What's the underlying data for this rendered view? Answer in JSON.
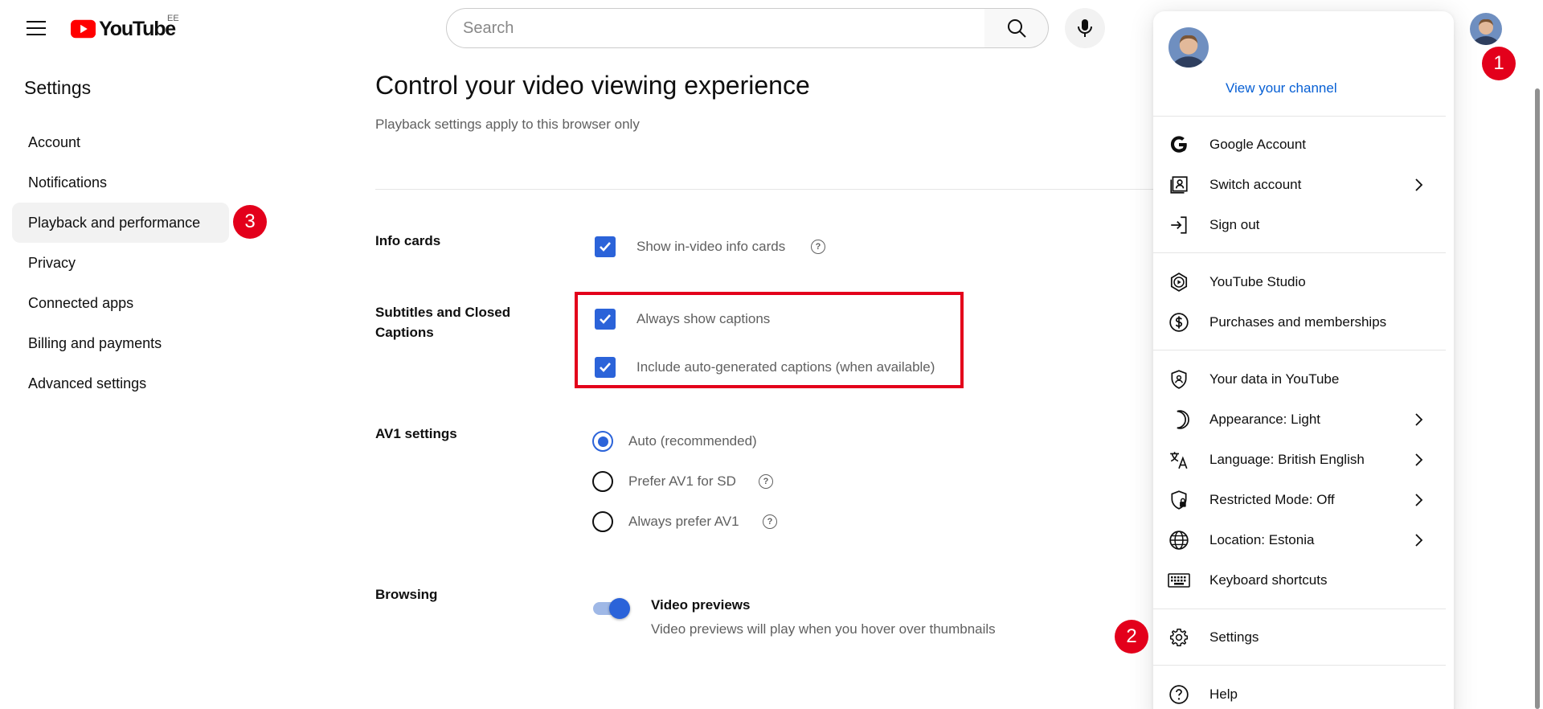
{
  "header": {
    "logo_text": "YouTube",
    "country_code": "EE",
    "search_placeholder": "Search"
  },
  "sidebar": {
    "title": "Settings",
    "items": [
      {
        "label": "Account"
      },
      {
        "label": "Notifications"
      },
      {
        "label": "Playback and performance",
        "active": true
      },
      {
        "label": "Privacy"
      },
      {
        "label": "Connected apps"
      },
      {
        "label": "Billing and payments"
      },
      {
        "label": "Advanced settings"
      }
    ]
  },
  "main": {
    "heading": "Control your video viewing experience",
    "subheading": "Playback settings apply to this browser only",
    "info_cards": {
      "label": "Info cards",
      "option": "Show in-video info cards",
      "checked": true
    },
    "captions": {
      "label": "Subtitles and Closed Captions",
      "options": [
        {
          "label": "Always show captions",
          "checked": true
        },
        {
          "label": "Include auto-generated captions (when available)",
          "checked": true
        }
      ]
    },
    "av1": {
      "label": "AV1 settings",
      "options": [
        {
          "label": "Auto (recommended)",
          "selected": true
        },
        {
          "label": "Prefer AV1 for SD",
          "selected": false
        },
        {
          "label": "Always prefer AV1",
          "selected": false
        }
      ]
    },
    "browsing": {
      "label": "Browsing",
      "toggle_title": "Video previews",
      "toggle_desc": "Video previews will play when you hover over thumbnails",
      "on": true
    }
  },
  "menu": {
    "view_channel": "View your channel",
    "items": [
      {
        "label": "Google Account",
        "icon": "google-icon"
      },
      {
        "label": "Switch account",
        "icon": "switch-account-icon",
        "chevron": true
      },
      {
        "label": "Sign out",
        "icon": "sign-out-icon"
      },
      {
        "label": "YouTube Studio",
        "icon": "studio-icon"
      },
      {
        "label": "Purchases and memberships",
        "icon": "dollar-icon"
      },
      {
        "label": "Your data in YouTube",
        "icon": "shield-icon"
      },
      {
        "label": "Appearance: Light",
        "icon": "moon-icon",
        "chevron": true
      },
      {
        "label": "Language: British English",
        "icon": "translate-icon",
        "chevron": true
      },
      {
        "label": "Restricted Mode: Off",
        "icon": "restricted-icon",
        "chevron": true
      },
      {
        "label": "Location: Estonia",
        "icon": "globe-icon",
        "chevron": true
      },
      {
        "label": "Keyboard shortcuts",
        "icon": "keyboard-icon"
      },
      {
        "label": "Settings",
        "icon": "gear-icon"
      },
      {
        "label": "Help",
        "icon": "help-icon"
      }
    ]
  },
  "annotations": {
    "badge1": "1",
    "badge2": "2",
    "badge3": "3",
    "color": "#e3001b"
  },
  "colors": {
    "accent": "#2b63d9",
    "link": "#065fd4",
    "youtube_red": "#ff0000"
  }
}
